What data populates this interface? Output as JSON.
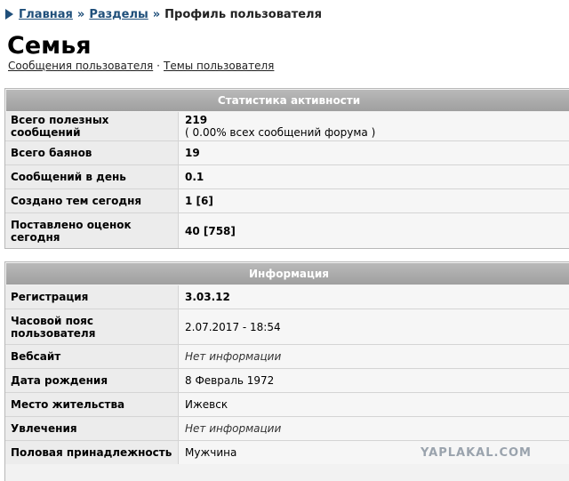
{
  "breadcrumb": {
    "home": "Главная",
    "sep1": "»",
    "sections": "Разделы",
    "sep2": "»",
    "current": "Профиль пользователя"
  },
  "page_title": "Семья",
  "subnav": {
    "messages": "Сообщения пользователя",
    "dot": "·",
    "topics": "Темы пользователя"
  },
  "stats": {
    "header": "Статистика активности",
    "rows": [
      {
        "label": "Всего полезных сообщений",
        "value": "219",
        "sub": "( 0.00% всех сообщений форума )"
      },
      {
        "label": "Всего баянов",
        "value": "19"
      },
      {
        "label": "Сообщений в день",
        "value": "0.1"
      },
      {
        "label": "Создано тем сегодня",
        "value": "1 [6]"
      },
      {
        "label": "Поставлено оценок сегодня",
        "value": "40 [758]"
      }
    ]
  },
  "info": {
    "header": "Информация",
    "rows": [
      {
        "label": "Регистрация",
        "value": "3.03.12"
      },
      {
        "label": "Часовой пояс пользователя",
        "value": "2.07.2017 - 18:54"
      },
      {
        "label": "Вебсайт",
        "value": "Нет информации"
      },
      {
        "label": "Дата рождения",
        "value": "8 Февраль 1972"
      },
      {
        "label": "Место жительства",
        "value": "Ижевск"
      },
      {
        "label": "Увлечения",
        "value": "Нет информации"
      },
      {
        "label": "Половая принадлежность",
        "value": "Мужчина"
      }
    ]
  },
  "watermark": "YAPLAKAL.COM"
}
